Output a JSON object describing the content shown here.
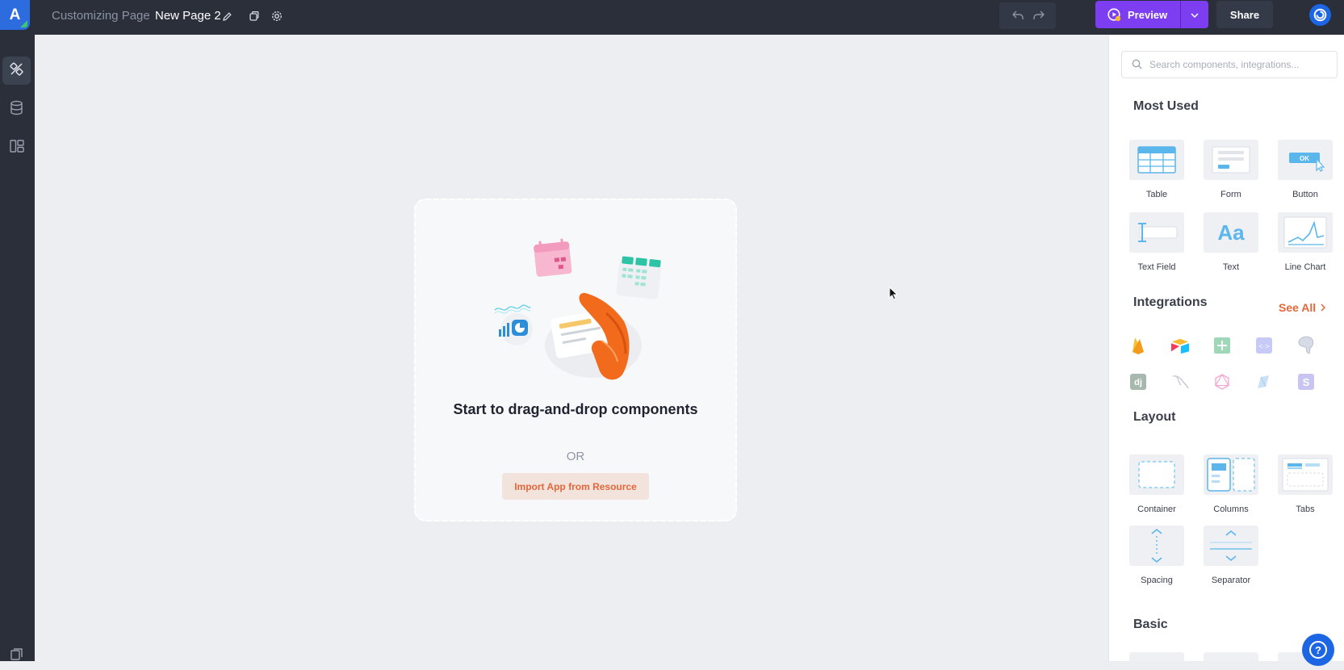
{
  "header": {
    "logo_letter": "A",
    "app_name": "Customizing Page",
    "page_name": "New Page 2",
    "preview_label": "Preview",
    "share_label": "Share"
  },
  "rail": {
    "items": [
      "component-icon",
      "database-icon",
      "layout-icon"
    ]
  },
  "canvas": {
    "title": "Start to drag-and-drop components",
    "or_label": "OR",
    "import_label": "Import App from Resource"
  },
  "panel": {
    "search_placeholder": "Search components, integrations...",
    "most_used_title": "Most Used",
    "most_used": [
      "Table",
      "Form",
      "Button",
      "Text Field",
      "Text",
      "Line Chart"
    ],
    "integrations_title": "Integrations",
    "see_all_label": "See All",
    "integrations": [
      "firebase-icon",
      "airtable-icon",
      "google-sheets-icon",
      "rest-api-icon",
      "postgresql-icon",
      "django-icon",
      "mysql-icon",
      "graphql-icon",
      "notion-icon",
      "supabase-icon"
    ],
    "layout_title": "Layout",
    "layout": [
      "Container",
      "Columns",
      "Tabs",
      "Spacing",
      "Separator"
    ],
    "basic_title": "Basic"
  },
  "colors": {
    "accent_purple": "#7d3df0",
    "accent_orange": "#e4673a",
    "topbar": "#2a2f3a",
    "brand_blue": "#2d6cdf"
  }
}
